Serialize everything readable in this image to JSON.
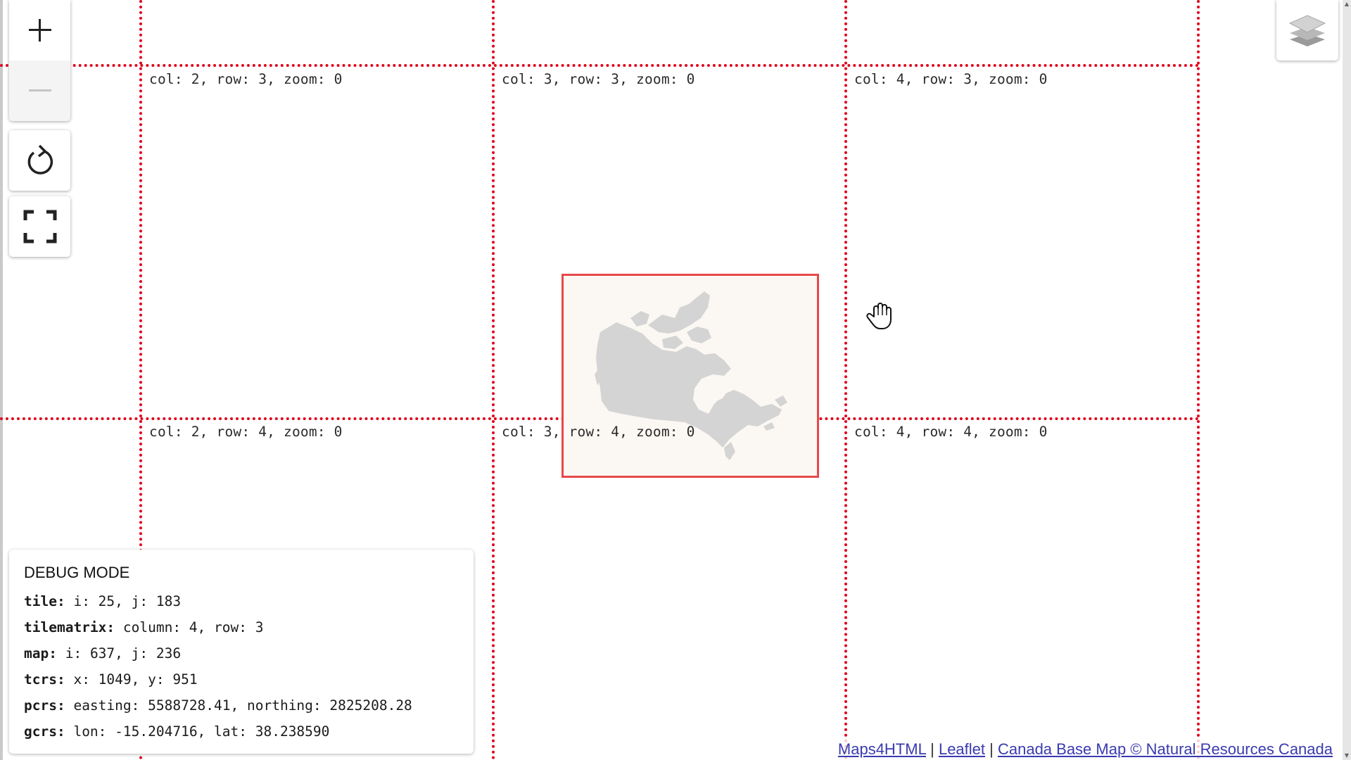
{
  "tile_labels": {
    "r0c0": "col: 2, row: 3, zoom: 0",
    "r0c1": "col: 3, row: 3, zoom: 0",
    "r0c2": "col: 4, row: 3, zoom: 0",
    "r1c0": "col: 2, row: 4, zoom: 0",
    "r1c1": "col: 3, row: 4, zoom: 0",
    "r1c2": "col: 4, row: 4, zoom: 0"
  },
  "controls": {
    "zoom_in": "plus-icon",
    "zoom_out": "minus-icon",
    "reload": "reload-icon",
    "fullscreen": "fullscreen-icon",
    "layers": "layers-icon"
  },
  "debug": {
    "title": "DEBUG MODE",
    "tile": {
      "key": "tile:",
      "value": "i: 25, j: 183"
    },
    "tilematrix": {
      "key": "tilematrix:",
      "value": "column: 4, row: 3"
    },
    "map": {
      "key": "map:",
      "value": "i: 637, j: 236"
    },
    "tcrs": {
      "key": "tcrs:",
      "value": "x: 1049, y: 951"
    },
    "pcrs": {
      "key": "pcrs:",
      "value": "easting: 5588728.41, northing: 2825208.28"
    },
    "gcrs": {
      "key": "gcrs:",
      "value": "lon: -15.204716, lat: 38.238590"
    }
  },
  "attribution": {
    "maps4html": "Maps4HTML",
    "separator": " | ",
    "leaflet": "Leaflet",
    "canada_base_map": "Canada Base Map © Natural Resources Canada"
  },
  "colors": {
    "grid_line": "#e0001b",
    "extent_border": "#e8484a",
    "land": "#d4d4d4",
    "link": "#3a3ab0"
  }
}
